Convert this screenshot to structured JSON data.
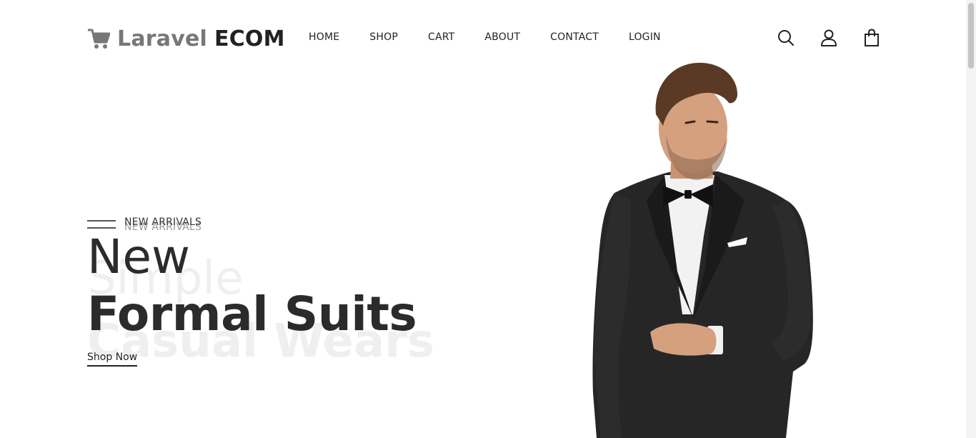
{
  "brand": {
    "name_light": "Laravel",
    "name_bold": "ECOM",
    "icon": "shopping-cart-icon"
  },
  "nav": {
    "items": [
      {
        "label": "HOME"
      },
      {
        "label": "SHOP"
      },
      {
        "label": "CART"
      },
      {
        "label": "ABOUT"
      },
      {
        "label": "CONTACT"
      },
      {
        "label": "LOGIN"
      }
    ]
  },
  "header_icons": [
    "search-icon",
    "user-icon",
    "shopping-bag-icon"
  ],
  "hero": {
    "subtitle": "NEW ARRIVALS",
    "subtitle_ghost": "NEW ARRIVALS",
    "title_line1": "New",
    "title_line2": "Formal Suits",
    "ghost_line1": "Simple",
    "ghost_line2": "Casual Wears",
    "cta": "Shop Now"
  },
  "colors": {
    "text": "#222222",
    "brand_light": "#777777",
    "ghost": "#efefef",
    "suit": "#262626",
    "shirt": "#f2f2f2",
    "skin": "#d4a07e",
    "hair": "#5a3a24"
  }
}
